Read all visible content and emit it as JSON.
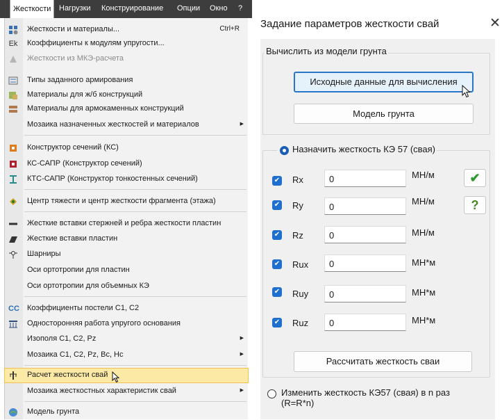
{
  "menubar": {
    "items": [
      "Жесткости",
      "Нагрузки",
      "Конструирование",
      "Опции",
      "Окно",
      "?"
    ]
  },
  "menu": {
    "items": [
      {
        "label": "Жесткости и материалы...",
        "shortcut": "Ctrl+R",
        "icon": "stiffness-materials-icon"
      },
      {
        "label": "Коэффициенты к модулям упругости...",
        "icon": "ek-icon",
        "icon_text": "Ek"
      },
      {
        "label": "Жесткости из МКЭ-расчета",
        "icon": "fem-stiffness-icon",
        "disabled": true
      },
      {
        "label": "Типы заданного армирования",
        "icon": "reinforcement-types-icon"
      },
      {
        "label": "Материалы для ж/б конструкций",
        "icon": "rc-materials-icon"
      },
      {
        "label": "Материалы для армокаменных конструкций",
        "icon": "masonry-materials-icon"
      },
      {
        "label": "Мозаика назначенных жесткостей и материалов",
        "submenu": true
      },
      {
        "label": "Конструктор сечений (КС)",
        "icon": "section-constructor-icon"
      },
      {
        "label": "КС-САПР (Конструктор сечений)",
        "icon": "ks-sapr-icon"
      },
      {
        "label": "КТС-САПР (Конструктор тонкостенных сечений)",
        "icon": "kts-sapr-icon"
      },
      {
        "label": "Центр тяжести и центр жесткости фрагмента (этажа)",
        "icon": "center-of-gravity-icon"
      },
      {
        "label": "Жесткие вставки стержней и ребра жесткости пластин",
        "icon": "rigid-inserts-bars-icon"
      },
      {
        "label": "Жесткие вставки пластин",
        "icon": "rigid-inserts-plates-icon"
      },
      {
        "label": "Шарниры",
        "icon": "hinge-icon"
      },
      {
        "label": "Оси ортотропии для пластин"
      },
      {
        "label": "Оси ортотропии для объемных КЭ"
      },
      {
        "label": "Коэффициенты постели С1, С2",
        "icon": "bed-coefficients-icon",
        "icon_text": "CC"
      },
      {
        "label": "Односторонняя работа упругого основания",
        "icon": "one-sided-foundation-icon"
      },
      {
        "label": "Изополя С1, С2, Pz",
        "submenu": true
      },
      {
        "label": "Мозаика С1, С2, Pz, Bc, Hc",
        "submenu": true
      },
      {
        "label": "Расчет жесткости свай",
        "icon": "pile-stiffness-icon",
        "highlighted": true
      },
      {
        "label": "Мозаика жесткостных характеристик свай",
        "submenu": true
      },
      {
        "label": "Модель грунта",
        "icon": "soil-model-icon"
      }
    ]
  },
  "dialog": {
    "title": "Задание параметров жесткости свай",
    "compute_group_label": "Вычислить из модели грунта",
    "initial_data_button": "Исходные данные для вычисления",
    "soil_model_button": "Модель грунта",
    "assign_radio_label": "Назначить жесткость КЭ 57 (свая)",
    "rows": [
      {
        "name": "Rx",
        "value": "0",
        "unit": "МН/м"
      },
      {
        "name": "Ry",
        "value": "0",
        "unit": "МН/м"
      },
      {
        "name": "Rz",
        "value": "0",
        "unit": "МН/м"
      },
      {
        "name": "Rux",
        "value": "0",
        "unit": "МН*м"
      },
      {
        "name": "Ruy",
        "value": "0",
        "unit": "МН*м"
      },
      {
        "name": "Ruz",
        "value": "0",
        "unit": "МН*м"
      }
    ],
    "apply_glyph": "✔",
    "help_glyph": "?",
    "calc_button": "Рассчитать жесткость сваи",
    "change_radio_line1": "Изменить жесткость КЭ57 (свая) в  n  раз",
    "change_radio_line2": "(R=R*n)"
  },
  "colors": {
    "menubar_bg": "#3d3d3d",
    "highlight": "#fde9a6",
    "checkbox": "#1f6fcf",
    "apply_green": "#2e9a2e",
    "help_green": "#4a8a22"
  }
}
